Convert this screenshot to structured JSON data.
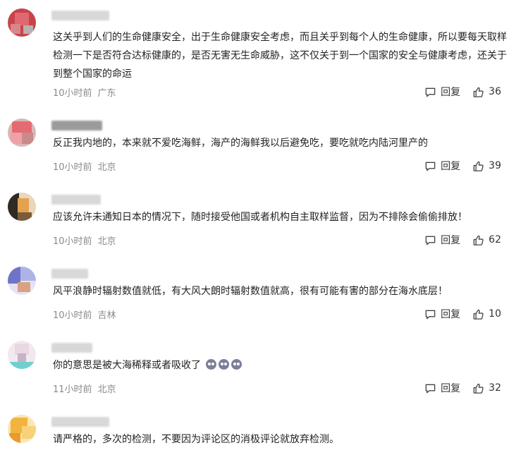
{
  "comments": [
    {
      "text": "这关乎到人们的生命健康安全，出于生命健康安全考虑，而且关乎到每个人的生命健康，所以要每天取样检测一下是否符合达标健康的，是否无害无生命威胁，这不仅关于到一个国家的安全与健康考虑，还关于到整个国家的命运",
      "time": "10小时前",
      "location": "广东",
      "reply_label": "回复",
      "likes": "36",
      "avatar_colors": [
        "#c9434b",
        "#e06870",
        "#d8868c",
        "#b9b0b0"
      ]
    },
    {
      "text": "反正我内地的，本来就不爱吃海鲜，海产的海鲜我以后避免吃，要吃就吃内陆河里产的",
      "time": "10小时前",
      "location": "北京",
      "reply_label": "回复",
      "likes": "39",
      "avatar_colors": [
        "#e66a72",
        "#f1a0a6",
        "#c98a8a",
        "#d9b7b7"
      ]
    },
    {
      "text": "应该允许未通知日本的情况下，随时接受他国或者机构自主取样监督，因为不排除会偷偷排放！",
      "time": "10小时前",
      "location": "北京",
      "reply_label": "回复",
      "likes": "62",
      "avatar_colors": [
        "#2f2a24",
        "#e3a24e",
        "#7a5c3a",
        "#e8d7bc"
      ]
    },
    {
      "text": "风平浪静时辐射数值就低，有大风大朗时辐射数值就高，很有可能有害的部分在海水底层！",
      "time": "10小时前",
      "location": "吉林",
      "reply_label": "回复",
      "likes": "10",
      "avatar_colors": [
        "#6f74c6",
        "#aeb3e6",
        "#d9a383",
        "#e7e2f3"
      ]
    },
    {
      "text": "你的意思是被大海稀释或者吸收了",
      "emoji_count": 3,
      "time": "11小时前",
      "location": "北京",
      "reply_label": "回复",
      "likes": "32",
      "avatar_colors": [
        "#e9d7e3",
        "#c7b2c6",
        "#6fcfcf",
        "#f2e9ef"
      ]
    },
    {
      "text": "请严格的，多次的检测，不要因为评论区的消极评论就放弃检测。",
      "avatar_colors": [
        "#f3b43f",
        "#f7d27b",
        "#e99b2c",
        "#fae6b5"
      ]
    }
  ]
}
